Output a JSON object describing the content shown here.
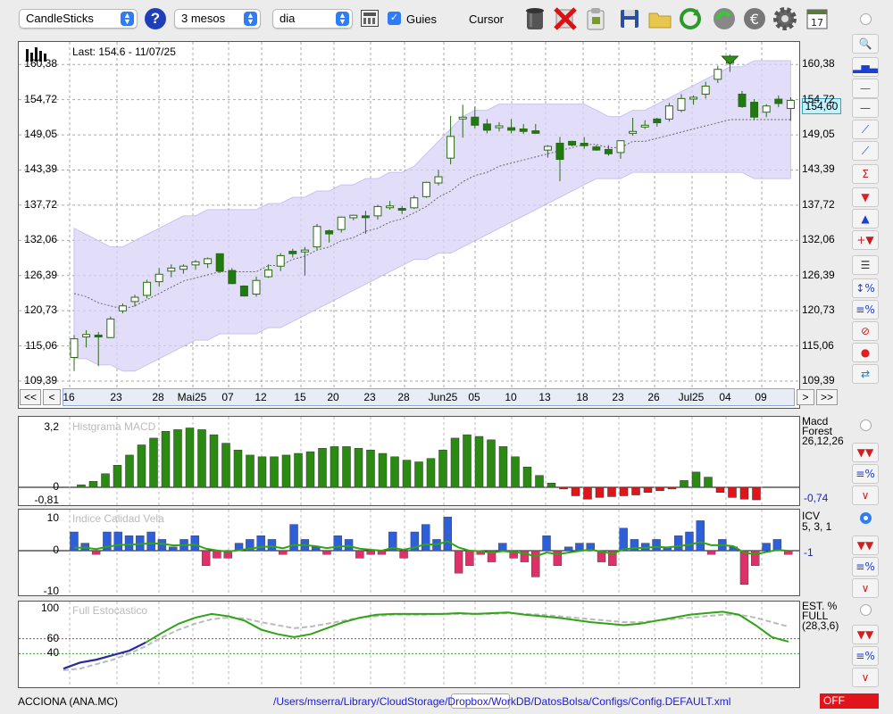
{
  "toolbar": {
    "chart_type": "CandleSticks",
    "period": "3 mesos",
    "interval": "dia",
    "guides_label": "Guies",
    "guides_checked": true,
    "cursor_label": "Cursor",
    "cursor_checked": false,
    "calendar_day": "17",
    "icons": [
      "help-icon",
      "calculator-icon",
      "trash-icon",
      "delete-icon",
      "clipboard-icon",
      "save-icon",
      "folder-icon",
      "refresh-icon",
      "update-icon",
      "currency-icon",
      "gear-icon",
      "calendar-icon"
    ]
  },
  "price": {
    "last_label": "Last: 154.6 - 11/07/25",
    "current": "154,60",
    "yticks": [
      "160,38",
      "154,72",
      "149,05",
      "143,39",
      "137,72",
      "132,06",
      "126,39",
      "120,73",
      "115,06",
      "109,39"
    ],
    "xlabels": [
      "16",
      "23",
      "28",
      "Mai25",
      "07",
      "12",
      "15",
      "20",
      "23",
      "28",
      "Jun25",
      "05",
      "10",
      "13",
      "18",
      "23",
      "26",
      "Jul25",
      "04",
      "09"
    ],
    "nav": [
      "<<",
      "<",
      ">",
      ">>"
    ]
  },
  "macd": {
    "title": "Histgrama MACD",
    "legend": [
      "Macd",
      "Forest",
      "26,12,26"
    ],
    "value": "-0,74",
    "yticks": [
      "3,2",
      "0",
      "-0,81"
    ]
  },
  "icv": {
    "title": "Indice Calidad Vela",
    "legend": [
      "ICV",
      "5, 3, 1"
    ],
    "value": "-1",
    "yticks": [
      "10",
      "0",
      "-10"
    ]
  },
  "stoch": {
    "title": "Full Estocastico",
    "legend": [
      "EST. %",
      "FULL",
      "(28,3,6)"
    ],
    "yticks": [
      "100",
      "60",
      "40"
    ]
  },
  "status": {
    "ticker": "ACCIONA (ANA.MC)",
    "path": "/Users/mserra/Library/CloudStorage/Dropbox/WorkDB/DatosBolsa/Configs/Config.DEFAULT.xml",
    "state": "OFF"
  },
  "colors": {
    "up": "#2b8a12",
    "down": "#1f7a10",
    "band": "#d9d3f7",
    "macd_pos": "#2b8a12",
    "macd_neg": "#e0141b",
    "icv_pos": "#2f5fd8",
    "icv_neg": "#e0306a",
    "signal": "#2fa415"
  },
  "chart_data": {
    "type": "candlestick",
    "ylim": [
      109.39,
      162
    ],
    "candles": [
      [
        113.2,
        116.8,
        111,
        116.2
      ],
      [
        116.5,
        117.6,
        114.8,
        116.9
      ],
      [
        116.8,
        117.3,
        111.8,
        116.5
      ],
      [
        116.4,
        119.8,
        116.3,
        119.4
      ],
      [
        120.7,
        121.9,
        120.3,
        121.5
      ],
      [
        122.2,
        123.3,
        121.4,
        122.9
      ],
      [
        123.2,
        125.7,
        122.7,
        125.3
      ],
      [
        125.4,
        127.6,
        124.6,
        126.6
      ],
      [
        127.1,
        128.2,
        126.1,
        127.6
      ],
      [
        127.4,
        128.2,
        126.7,
        127.9
      ],
      [
        128.1,
        128.9,
        127.3,
        128.6
      ],
      [
        128.3,
        129.3,
        127.6,
        129.1
      ],
      [
        129.9,
        129.8,
        126.8,
        127.1
      ],
      [
        127.2,
        127.6,
        125.0,
        125.1
      ],
      [
        124.7,
        124.8,
        123.0,
        123.1
      ],
      [
        123.4,
        126.2,
        123.0,
        125.6
      ],
      [
        126.2,
        128.2,
        126.0,
        127.3
      ],
      [
        127.9,
        130.0,
        127.1,
        129.6
      ],
      [
        130.3,
        130.7,
        129.3,
        129.9
      ],
      [
        130.2,
        131.0,
        126.4,
        130.5
      ],
      [
        131.0,
        134.7,
        130.6,
        134.3
      ],
      [
        133.6,
        133.8,
        131.7,
        133.1
      ],
      [
        133.8,
        135.9,
        133.3,
        135.8
      ],
      [
        135.7,
        136.2,
        135.3,
        136.1
      ],
      [
        136.0,
        136.8,
        133.1,
        135.8
      ],
      [
        136.0,
        137.8,
        135.4,
        137.5
      ],
      [
        137.6,
        138.4,
        137.0,
        137.6
      ],
      [
        137.2,
        137.6,
        136.3,
        137.1
      ],
      [
        137.3,
        139.3,
        137.1,
        138.9
      ],
      [
        139.1,
        141.5,
        138.9,
        141.4
      ],
      [
        141.3,
        143.4,
        140.9,
        142.3
      ],
      [
        145.3,
        152.1,
        144.3,
        148.8
      ],
      [
        151.7,
        153.9,
        148.6,
        151.9
      ],
      [
        151.9,
        153.6,
        150.1,
        150.6
      ],
      [
        150.8,
        151.6,
        149.3,
        149.8
      ],
      [
        150.2,
        151.1,
        149.6,
        150.5
      ],
      [
        150.2,
        151.6,
        149.3,
        149.8
      ],
      [
        150.0,
        150.8,
        149.2,
        149.6
      ],
      [
        149.7,
        150.8,
        149.2,
        149.3
      ],
      [
        146.6,
        147.4,
        145.4,
        147.2
      ],
      [
        147.7,
        148.7,
        141.6,
        145.1
      ],
      [
        148.0,
        148.1,
        147.2,
        147.4
      ],
      [
        147.7,
        148.7,
        146.8,
        147.3
      ],
      [
        147.1,
        147.4,
        146.5,
        146.6
      ],
      [
        146.7,
        147.4,
        145.7,
        146.0
      ],
      [
        146.2,
        148.2,
        145.2,
        148.1
      ],
      [
        149.3,
        151.8,
        148.9,
        149.6
      ],
      [
        150.5,
        151.4,
        150.0,
        150.6
      ],
      [
        151.6,
        151.8,
        150.4,
        151.0
      ],
      [
        151.6,
        154.2,
        151.2,
        153.7
      ],
      [
        153.0,
        155.6,
        152.7,
        154.9
      ],
      [
        155.0,
        155.4,
        153.9,
        155.1
      ],
      [
        155.6,
        157.6,
        154.9,
        156.9
      ],
      [
        158.0,
        160.2,
        157.4,
        159.6
      ],
      [
        160.6,
        162.0,
        159.2,
        161.1
      ],
      [
        155.6,
        156.1,
        153.4,
        153.6
      ],
      [
        154.3,
        154.8,
        151.4,
        151.9
      ],
      [
        152.7,
        154.0,
        151.9,
        153.7
      ],
      [
        154.8,
        155.4,
        153.5,
        154.1
      ],
      [
        153.3,
        155.1,
        151.3,
        154.6
      ]
    ],
    "band_upper": [
      134,
      133,
      132,
      131,
      131,
      132,
      133,
      134,
      135,
      136,
      136,
      137,
      137,
      137,
      137,
      137,
      138,
      138,
      139,
      139,
      140,
      140,
      141,
      141,
      142,
      142,
      143,
      143,
      144,
      146,
      148,
      150,
      152,
      153,
      153,
      154,
      154,
      154,
      154,
      154,
      154,
      154,
      154,
      153,
      152,
      152,
      153,
      153,
      154,
      155,
      156,
      157,
      158,
      159,
      160,
      160,
      161,
      161,
      161,
      161
    ],
    "band_lower": [
      113,
      113,
      112,
      112,
      111,
      111,
      112,
      113,
      114,
      115,
      116,
      116,
      117,
      117,
      117,
      117,
      118,
      118,
      119,
      120,
      121,
      122,
      123,
      124,
      125,
      126,
      127,
      128,
      129,
      129,
      130,
      130,
      131,
      132,
      133,
      134,
      135,
      136,
      137,
      138,
      139,
      140,
      141,
      142,
      142,
      142,
      143,
      143,
      143,
      143,
      143,
      143,
      143,
      143,
      143,
      143,
      142,
      142,
      142,
      142
    ],
    "macd_hist": [
      0.15,
      0.35,
      0.8,
      1.3,
      1.9,
      2.5,
      2.9,
      3.3,
      3.4,
      3.5,
      3.4,
      3.1,
      2.6,
      2.2,
      1.9,
      1.8,
      1.8,
      1.9,
      2.0,
      2.1,
      2.3,
      2.4,
      2.4,
      2.3,
      2.2,
      2.0,
      1.8,
      1.6,
      1.5,
      1.7,
      2.2,
      2.9,
      3.1,
      3.0,
      2.8,
      2.4,
      1.8,
      1.2,
      0.7,
      0.25,
      -0.1,
      -0.5,
      -0.7,
      -0.6,
      -0.55,
      -0.5,
      -0.45,
      -0.3,
      -0.2,
      -0.1,
      0.4,
      0.9,
      0.6,
      -0.3,
      -0.6,
      -0.7,
      -0.74
    ],
    "icv_bars": [
      5,
      2,
      -1,
      5,
      5,
      4,
      4,
      5,
      3,
      1,
      3,
      4,
      -4,
      -2,
      -2,
      2,
      3,
      4,
      3,
      -1,
      7,
      3,
      1,
      -1,
      4,
      3,
      -2,
      -1,
      -1,
      5,
      -2,
      5,
      7,
      3,
      9,
      -6,
      -4,
      -1,
      -3,
      2,
      -2,
      -3,
      -7,
      4,
      -4,
      1,
      2,
      2,
      -3,
      -4,
      6,
      3,
      2,
      3,
      1,
      4,
      5,
      8,
      -1,
      3,
      1,
      -9,
      -4,
      2,
      3,
      -1
    ],
    "stoch_k": [
      20,
      28,
      32,
      38,
      44,
      55,
      68,
      80,
      88,
      93,
      90,
      84,
      72,
      66,
      62,
      66,
      74,
      82,
      88,
      92,
      93,
      93,
      93,
      93,
      94,
      93,
      94,
      95,
      92,
      90,
      88,
      85,
      82,
      80,
      78,
      80,
      84,
      88,
      92,
      94,
      96,
      92,
      78,
      62,
      56
    ],
    "stoch_d": [
      18,
      20,
      26,
      32,
      40,
      50,
      62,
      72,
      80,
      86,
      88,
      87,
      82,
      78,
      74,
      76,
      80,
      84,
      88,
      90,
      92,
      92,
      92,
      93,
      93,
      93,
      93,
      94,
      93,
      92,
      90,
      88,
      86,
      84,
      82,
      82,
      84,
      86,
      88,
      90,
      92,
      92,
      88,
      82,
      76
    ]
  }
}
